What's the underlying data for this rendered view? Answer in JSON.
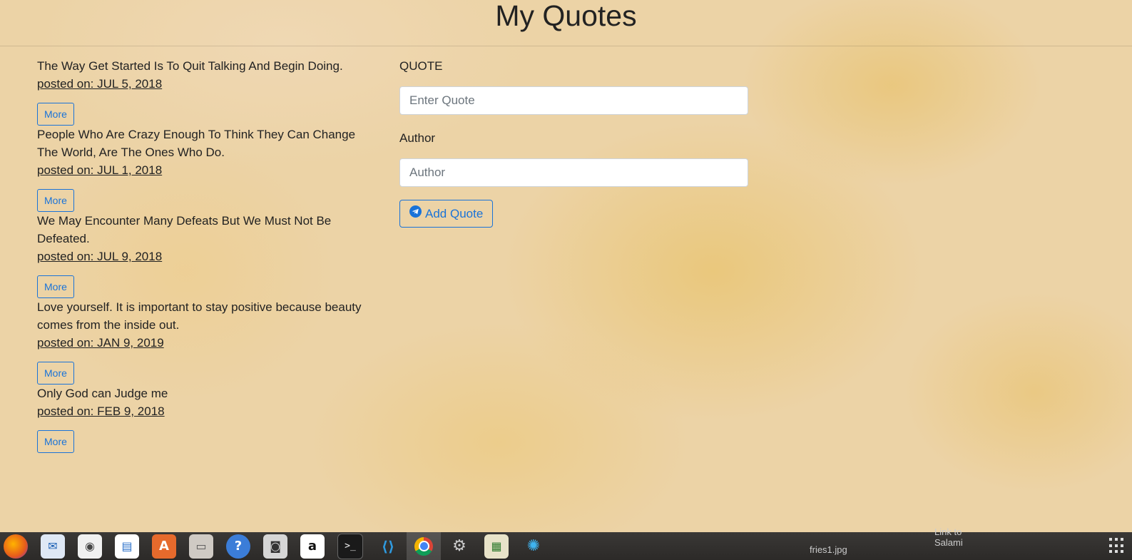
{
  "header": {
    "title": "My Quotes"
  },
  "quotes": [
    {
      "text": "The Way Get Started Is To Quit Talking And Begin Doing.",
      "date": "posted on: JUL 5, 2018",
      "more_label": "More"
    },
    {
      "text": "People Who Are Crazy Enough To Think They Can Change The World, Are The Ones Who Do.",
      "date": "posted on: JUL 1, 2018",
      "more_label": "More"
    },
    {
      "text": "We May Encounter Many Defeats But We Must Not Be Defeated.",
      "date": "posted on: JUL 9, 2018",
      "more_label": "More"
    },
    {
      "text": "Love yourself. It is important to stay positive because beauty comes from the inside out.",
      "date": "posted on: JAN 9, 2019",
      "more_label": "More"
    },
    {
      "text": "Only God can Judge me",
      "date": "posted on: FEB 9, 2018",
      "more_label": "More"
    }
  ],
  "form": {
    "quote_label": "QUOTE",
    "quote_placeholder": "Enter Quote",
    "quote_value": "",
    "author_label": "Author",
    "author_placeholder": "Author",
    "author_value": "",
    "submit_label": "Add Quote",
    "submit_icon": "send-icon"
  },
  "colors": {
    "accent": "#1a73d8",
    "text": "#222222",
    "background": "#ecd3a6"
  },
  "taskbar": {
    "apps": [
      {
        "icon": "firefox-icon",
        "glyph": "🦊"
      },
      {
        "icon": "mail-icon",
        "glyph": "✉"
      },
      {
        "icon": "audio-icon",
        "glyph": "◉"
      },
      {
        "icon": "document-icon",
        "glyph": "▤"
      },
      {
        "icon": "store-icon",
        "glyph": "A"
      },
      {
        "icon": "files-icon",
        "glyph": "▭"
      },
      {
        "icon": "help-icon",
        "glyph": "?"
      },
      {
        "icon": "camera-icon",
        "glyph": "◙"
      },
      {
        "icon": "amazon-icon",
        "glyph": "a"
      },
      {
        "icon": "terminal-icon",
        "glyph": ">_"
      },
      {
        "icon": "vscode-icon",
        "glyph": "⟨⟩"
      },
      {
        "icon": "chrome-icon",
        "glyph": "◎"
      },
      {
        "icon": "settings-icon",
        "glyph": "⚙"
      },
      {
        "icon": "monitor-icon",
        "glyph": "▦"
      },
      {
        "icon": "splash-icon",
        "glyph": "✺"
      }
    ],
    "desktop_items": [
      {
        "label": "fries1.jpg"
      },
      {
        "label": "Link to Salami"
      }
    ]
  }
}
